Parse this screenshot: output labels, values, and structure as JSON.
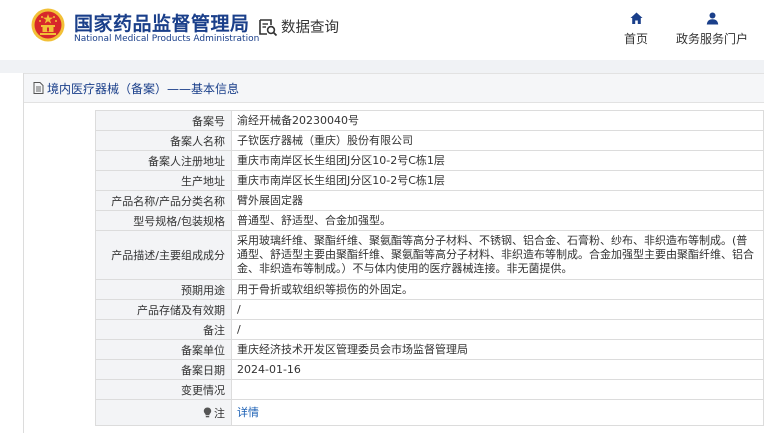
{
  "header": {
    "brand_cn": "国家药品监督管理局",
    "brand_en": "National Medical Products Administration",
    "query_label": "数据查询",
    "nav": [
      {
        "label": "首页",
        "icon": "home-icon"
      },
      {
        "label": "政务服务门户",
        "icon": "user-icon"
      }
    ]
  },
  "panel": {
    "title": "境内医疗器械（备案）——基本信息"
  },
  "rows": [
    {
      "key": "备案号",
      "value": "渝经开械备20230040号"
    },
    {
      "key": "备案人名称",
      "value": "子钦医疗器械（重庆）股份有限公司"
    },
    {
      "key": "备案人注册地址",
      "value": "重庆市南岸区长生组团J分区10-2号C栋1层"
    },
    {
      "key": "生产地址",
      "value": "重庆市南岸区长生组团J分区10-2号C栋1层"
    },
    {
      "key": "产品名称/产品分类名称",
      "value": "臂外展固定器"
    },
    {
      "key": "型号规格/包装规格",
      "value": "普通型、舒适型、合金加强型。"
    },
    {
      "key": "产品描述/主要组成成分",
      "value": "采用玻璃纤维、聚酯纤维、聚氨酯等高分子材料、不锈钢、铝合金、石膏粉、纱布、非织造布等制成。(普通型、舒适型主要由聚酯纤维、聚氨酯等高分子材料、非织造布等制成。合金加强型主要由聚酯纤维、铝合金、非织造布等制成。）不与体内使用的医疗器械连接。非无菌提供。"
    },
    {
      "key": "预期用途",
      "value": "用于骨折或软组织等损伤的外固定。"
    },
    {
      "key": "产品存储及有效期",
      "value": "/"
    },
    {
      "key": "备注",
      "value": "/"
    },
    {
      "key": "备案单位",
      "value": "重庆经济技术开发区管理委员会市场监督管理局"
    },
    {
      "key": "备案日期",
      "value": "2024-01-16"
    },
    {
      "key": "变更情况",
      "value": ""
    },
    {
      "key": "注",
      "value": "详情",
      "icon": "bulb-icon"
    }
  ],
  "colors": {
    "brand_blue": "#1a3f8a",
    "link_blue": "#1a5fb4",
    "emblem_red": "#d7282b",
    "emblem_gold": "#f2c037"
  }
}
